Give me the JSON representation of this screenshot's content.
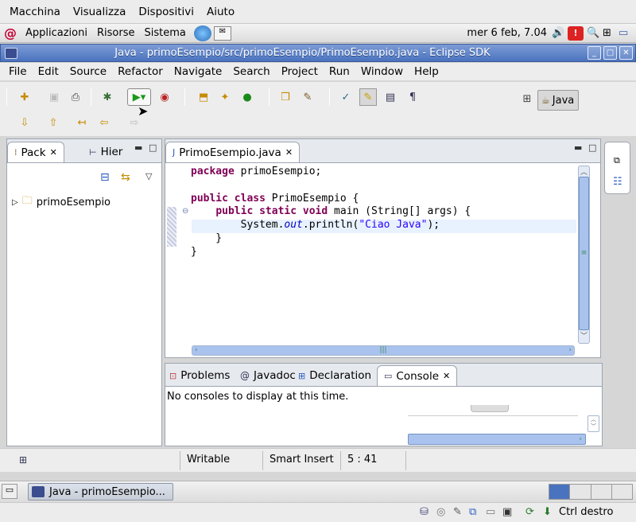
{
  "vbox_menu": [
    "Macchina",
    "Visualizza",
    "Dispositivi",
    "Aiuto"
  ],
  "gnome_panel": {
    "items": [
      "Applicazioni",
      "Risorse",
      "Sistema"
    ],
    "clock": "mer  6 feb, 7.04"
  },
  "window": {
    "title": "Java - primoEsempio/src/primoEsempio/PrimoEsempio.java - Eclipse SDK"
  },
  "menubar": [
    "File",
    "Edit",
    "Source",
    "Refactor",
    "Navigate",
    "Search",
    "Project",
    "Run",
    "Window",
    "Help"
  ],
  "perspective": {
    "label": "Java"
  },
  "left_panel": {
    "tabs": [
      "Pack",
      "Hier"
    ],
    "tree": [
      "primoEsempio"
    ]
  },
  "editor": {
    "tab": "PrimoEsempio.java"
  },
  "bottom_panel": {
    "tabs": [
      "Problems",
      "Javadoc",
      "Declaration",
      "Console"
    ],
    "message": "No consoles to display at this time."
  },
  "status": {
    "writable": "Writable",
    "mode": "Smart Insert",
    "position": "5 : 41"
  },
  "taskbar": {
    "item": "Java - primoEsempio..."
  },
  "vbox_status": {
    "host_key": "Ctrl destro"
  }
}
